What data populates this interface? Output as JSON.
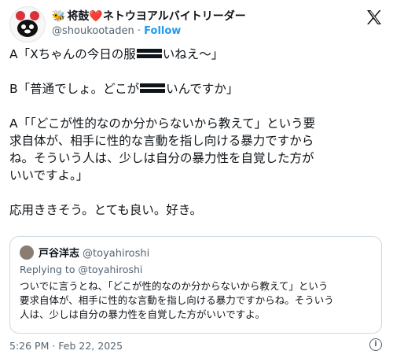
{
  "author": {
    "badge": "🐝",
    "name": "将鼓❤️ネトウヨアルバイトリーダー",
    "handle": "@shoukootaden",
    "separator": "·",
    "follow_label": "Follow"
  },
  "tweet": {
    "lines": [
      [
        "A「Xちゃんの今日の服",
        "いねえ～」"
      ],
      [
        "B「普通でしょ。どこが",
        "いんですか」"
      ],
      [
        "A「「どこが性的なのか分からないから教えて」という要"
      ],
      [
        "求自体が、相手に性的な言動を指し向ける暴力ですから"
      ],
      [
        "ね。そういう人は、少しは自分の暴力性を自覚した方が"
      ],
      [
        "いいですよ。」"
      ],
      [
        "応用ききそう。とても良い。好き。"
      ]
    ]
  },
  "quote": {
    "name": "戸谷洋志",
    "handle": "@toyahiroshi",
    "replying": "Replying to @toyahiroshi",
    "lines": [
      "ついでに言うとね、「どこが性的なのか分からないから教えて」という",
      "要求自体が、相手に性的な言動を指し向ける暴力ですからね。そういう",
      "人は、少しは自分の暴力性を自覚した方がいいですよ。"
    ]
  },
  "footer": {
    "timestamp": "5:26 PM · Feb 22, 2025",
    "info_glyph": "i"
  }
}
